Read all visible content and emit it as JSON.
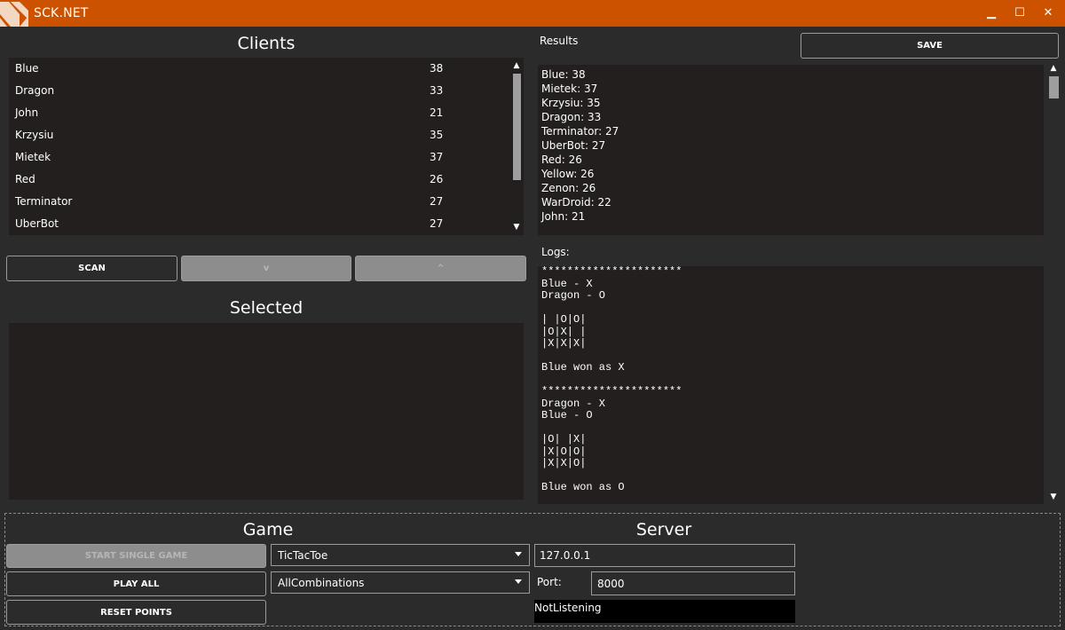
{
  "window": {
    "title": "SCK.NET",
    "minimize_glyph": "▁",
    "maximize_glyph": "☐",
    "close_glyph": "✕"
  },
  "clients": {
    "heading": "Clients",
    "items": [
      {
        "name": "Blue",
        "score": "38"
      },
      {
        "name": "Dragon",
        "score": "33"
      },
      {
        "name": "John",
        "score": "21"
      },
      {
        "name": "Krzysiu",
        "score": "35"
      },
      {
        "name": "Mietek",
        "score": "37"
      },
      {
        "name": "Red",
        "score": "26"
      },
      {
        "name": "Terminator",
        "score": "27"
      },
      {
        "name": "UberBot",
        "score": "27"
      }
    ]
  },
  "client_buttons": {
    "scan": "SCAN",
    "move_down": "v",
    "move_up": "^"
  },
  "selected": {
    "heading": "Selected"
  },
  "results": {
    "label": "Results",
    "save_label": "SAVE",
    "items": [
      "Blue: 38",
      "Mietek: 37",
      "Krzysiu: 35",
      "Dragon: 33",
      "Terminator: 27",
      "UberBot: 27",
      "Red: 26",
      "Yellow: 26",
      "Zenon: 26",
      "WarDroid: 22",
      "John: 21"
    ]
  },
  "logs": {
    "label": "Logs:",
    "text": "**********************\nBlue - X\nDragon - O\n\n| |O|O|\n|O|X| |\n|X|X|X|\n\nBlue won as X\n\n**********************\nDragon - X\nBlue - O\n\n|O| |X|\n|X|O|O|\n|X|X|O|\n\nBlue won as O"
  },
  "game": {
    "heading": "Game",
    "start_single_game": "START SINGLE GAME",
    "play_all": "PLAY ALL",
    "reset_points": "RESET POINTS",
    "game_select_value": "TicTacToe",
    "mode_select_value": "AllCombinations"
  },
  "server": {
    "heading": "Server",
    "address_value": "127.0.0.1",
    "port_label": "Port:",
    "port_value": "8000",
    "status_text": "NotListening"
  },
  "colors": {
    "titlebar": "#cc5200",
    "background": "#2b2b2b",
    "panel": "#231f1f"
  }
}
